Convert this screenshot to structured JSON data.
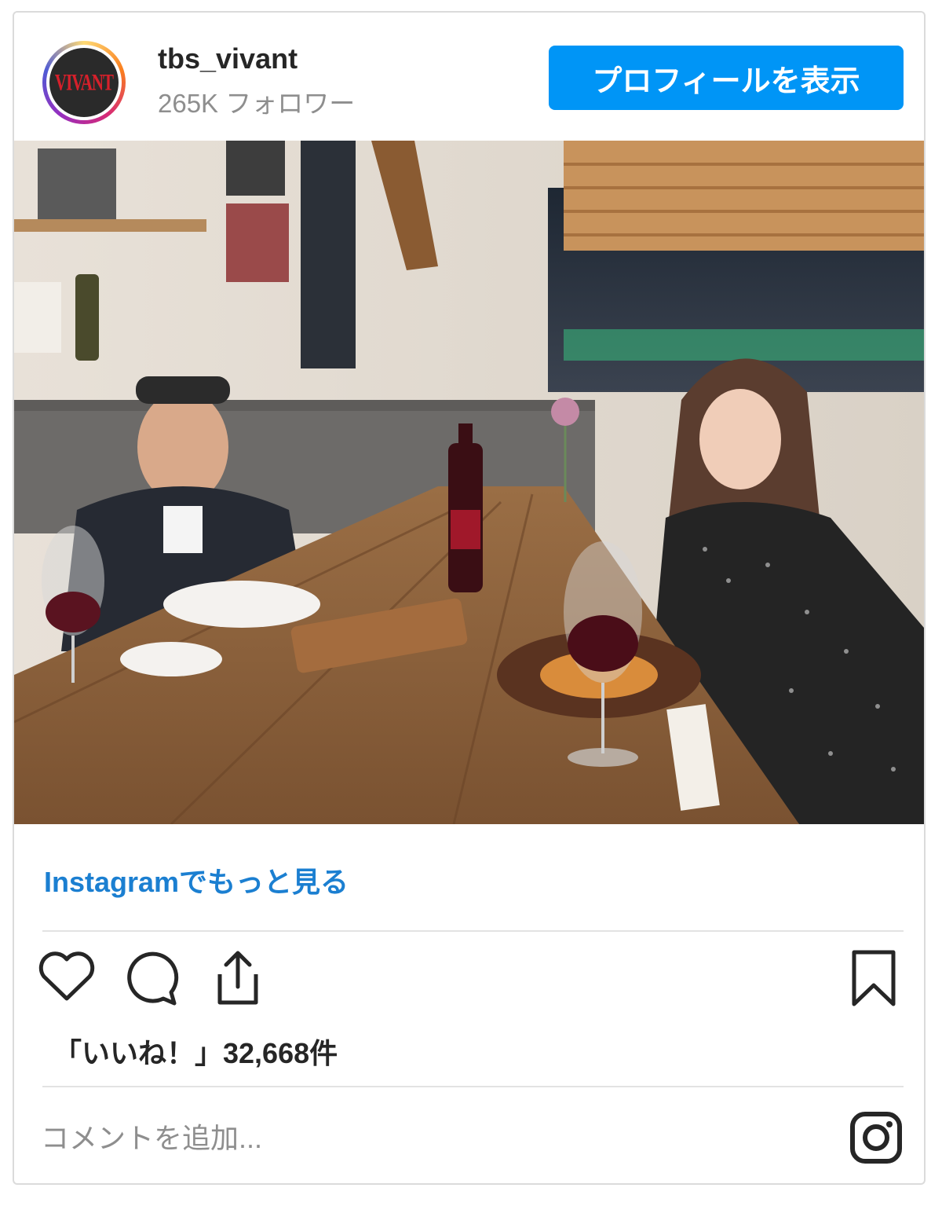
{
  "account": {
    "username": "tbs_vivant",
    "followers": "265K フォロワー",
    "avatar_text": "VIVANT"
  },
  "header": {
    "profile_button_label": "プロフィールを表示"
  },
  "post": {
    "image_icon": "photo-restaurant-dinner",
    "more_link": "Instagramでもっと見る",
    "likes": "「いいね！」32,668件",
    "comment_placeholder": "コメントを追加..."
  },
  "icons": {
    "like": "heart-icon",
    "comment": "comment-icon",
    "share": "share-icon",
    "save": "bookmark-icon",
    "instagram": "instagram-icon"
  },
  "colors": {
    "button": "#0095f6",
    "link": "#1b7fd1",
    "muted": "#8e8e8e"
  }
}
